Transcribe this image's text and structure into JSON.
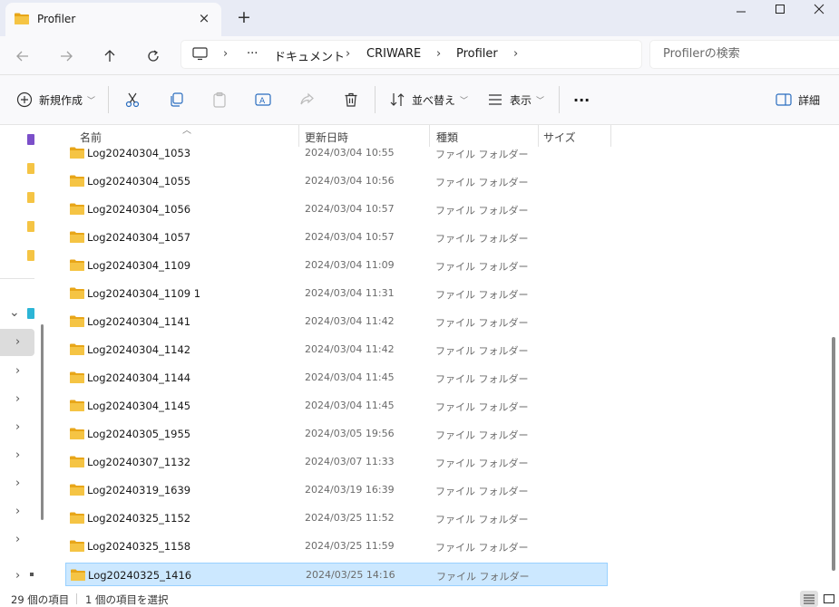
{
  "window": {
    "tab_title": "Profiler",
    "tab_close": "×",
    "new_tab": "+",
    "min": "—",
    "max": "☐",
    "close": "✕"
  },
  "address": {
    "more": "···",
    "breadcrumb": [
      "ドキュメント",
      "CRIWARE",
      "Profiler"
    ],
    "search_placeholder": "Profilerの検索"
  },
  "toolbar": {
    "new_label": "新規作成",
    "sort_label": "並べ替え",
    "view_label": "表示",
    "more": "···",
    "details_label": "詳細"
  },
  "columns": {
    "name": "名前",
    "date": "更新日時",
    "type": "種類",
    "size": "サイズ"
  },
  "files": [
    {
      "name": "Log20240304_1053",
      "date": "2024/03/04 10:55",
      "type": "ファイル フォルダー"
    },
    {
      "name": "Log20240304_1055",
      "date": "2024/03/04 10:56",
      "type": "ファイル フォルダー"
    },
    {
      "name": "Log20240304_1056",
      "date": "2024/03/04 10:57",
      "type": "ファイル フォルダー"
    },
    {
      "name": "Log20240304_1057",
      "date": "2024/03/04 10:57",
      "type": "ファイル フォルダー"
    },
    {
      "name": "Log20240304_1109",
      "date": "2024/03/04 11:09",
      "type": "ファイル フォルダー"
    },
    {
      "name": "Log20240304_1109 1",
      "date": "2024/03/04 11:31",
      "type": "ファイル フォルダー"
    },
    {
      "name": "Log20240304_1141",
      "date": "2024/03/04 11:42",
      "type": "ファイル フォルダー"
    },
    {
      "name": "Log20240304_1142",
      "date": "2024/03/04 11:42",
      "type": "ファイル フォルダー"
    },
    {
      "name": "Log20240304_1144",
      "date": "2024/03/04 11:45",
      "type": "ファイル フォルダー"
    },
    {
      "name": "Log20240304_1145",
      "date": "2024/03/04 11:45",
      "type": "ファイル フォルダー"
    },
    {
      "name": "Log20240305_1955",
      "date": "2024/03/05 19:56",
      "type": "ファイル フォルダー"
    },
    {
      "name": "Log20240307_1132",
      "date": "2024/03/07 11:33",
      "type": "ファイル フォルダー"
    },
    {
      "name": "Log20240319_1639",
      "date": "2024/03/19 16:39",
      "type": "ファイル フォルダー"
    },
    {
      "name": "Log20240325_1152",
      "date": "2024/03/25 11:52",
      "type": "ファイル フォルダー"
    },
    {
      "name": "Log20240325_1158",
      "date": "2024/03/25 11:59",
      "type": "ファイル フォルダー"
    },
    {
      "name": "Log20240325_1416",
      "date": "2024/03/25 14:16",
      "type": "ファイル フォルダー",
      "selected": true
    }
  ],
  "status": {
    "item_count": "29 個の項目",
    "selected": "1 個の項目を選択"
  },
  "colors": {
    "titlebar": "#e8ebf5",
    "selection": "#cce8ff",
    "selection_border": "#99d1ff",
    "folder": "#f5c444"
  }
}
